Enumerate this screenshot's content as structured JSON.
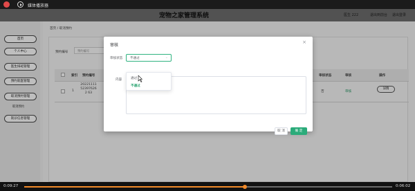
{
  "player": {
    "title": "媒体播放器",
    "current_time": "0:09:27",
    "total_time": "0:06:02",
    "progress": 0.6
  },
  "site": {
    "title": "宠物之家管理系统",
    "header_links": [
      "医生 222",
      "退出到前台",
      "退出登录"
    ]
  },
  "sidebar": {
    "items": [
      "首页",
      "个人中心",
      "医生排班管理",
      "预约就医管理",
      "取消预约管理",
      "就诊信息管理"
    ],
    "sub_item": "取消预约"
  },
  "main": {
    "breadcrumb": "首页 / 取消预约",
    "search_label": "预约编号",
    "search_placeholder": "预约编号",
    "table": {
      "headers": [
        "索引",
        "预约编号",
        "审核状态",
        "审核",
        "操作"
      ],
      "rows": [
        {
          "index": "1",
          "order_no": "20221111523976262 63",
          "status": "否",
          "review_link": "审核",
          "action": "详情"
        }
      ]
    }
  },
  "modal": {
    "title": "审核",
    "status_label": "审核状态",
    "content_label": "内容",
    "select_value": "不通过",
    "options": [
      "通过",
      "不通过"
    ],
    "selected_option": "不通过",
    "cancel_label": "取 消",
    "ok_label": "确 定"
  },
  "colors": {
    "accent": "#2bab7a",
    "progress": "#f08a2a"
  }
}
